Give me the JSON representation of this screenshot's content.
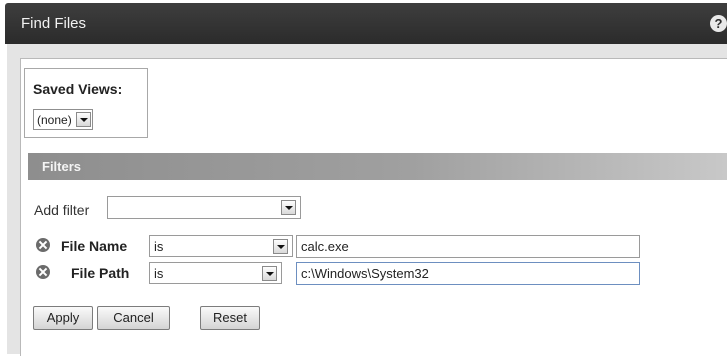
{
  "window": {
    "title": "Find Files",
    "help_glyph": "?"
  },
  "saved_views": {
    "label": "Saved Views:",
    "selected": "(none)"
  },
  "filters": {
    "section_label": "Filters",
    "add_filter_label": "Add filter",
    "add_filter_value": "",
    "rows": [
      {
        "label": "File Name",
        "operator": "is",
        "value": "calc.exe"
      },
      {
        "label": "File Path",
        "operator": "is",
        "value": "c:\\Windows\\System32"
      }
    ]
  },
  "buttons": {
    "apply": "Apply",
    "cancel": "Cancel",
    "reset": "Reset"
  },
  "icons": {
    "remove": "remove-filter-icon",
    "dropdown": "chevron-down-icon",
    "help": "help-icon"
  }
}
